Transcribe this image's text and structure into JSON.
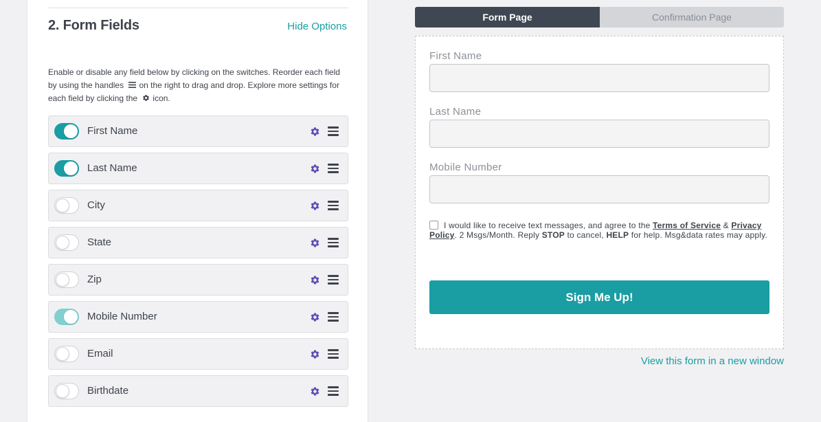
{
  "builder": {
    "section_title": "2. Form Fields",
    "hide_options_label": "Hide Options",
    "instructions": {
      "part1": "Enable or disable any field below by clicking on the switches. Reorder each field by using the handles",
      "part2": "on the right to drag and drop. Explore more settings for each field by clicking the",
      "part3": "icon."
    },
    "fields": [
      {
        "label": "First Name",
        "enabled": true
      },
      {
        "label": "Last Name",
        "enabled": true
      },
      {
        "label": "City",
        "enabled": false
      },
      {
        "label": "State",
        "enabled": false
      },
      {
        "label": "Zip",
        "enabled": false
      },
      {
        "label": "Mobile Number",
        "enabled": true,
        "faded": true
      },
      {
        "label": "Email",
        "enabled": false
      },
      {
        "label": "Birthdate",
        "enabled": false
      }
    ]
  },
  "preview": {
    "tabs": [
      {
        "label": "Form Page",
        "active": true
      },
      {
        "label": "Confirmation Page",
        "active": false
      }
    ],
    "form_fields": [
      {
        "label": "First Name",
        "value": ""
      },
      {
        "label": "Last Name",
        "value": ""
      },
      {
        "label": "Mobile Number",
        "value": ""
      }
    ],
    "consent": {
      "text1": "I would like to receive text messages, and agree to the",
      "terms_link": "Terms of Service",
      "amp": "&",
      "privacy_link": "Privacy Policy",
      "text2": ". 2 Msgs/Month. Reply",
      "stop": "STOP",
      "text3": "to cancel,",
      "help": "HELP",
      "text4": "for help. Msg&data rates may apply.",
      "checked": false
    },
    "submit_label": "Sign Me Up!",
    "view_link": "View this form in a new window"
  },
  "colors": {
    "accent": "#1a9da3",
    "accent_faded": "#82cfcf",
    "gear": "#5b4fb5",
    "tab_active": "#3f4852",
    "tab_inactive": "#d3d5d9",
    "text": "#3e434b",
    "background": "#f1f1f3"
  },
  "icons": {
    "gear": "gear-icon",
    "handle": "drag-handle-icon"
  }
}
